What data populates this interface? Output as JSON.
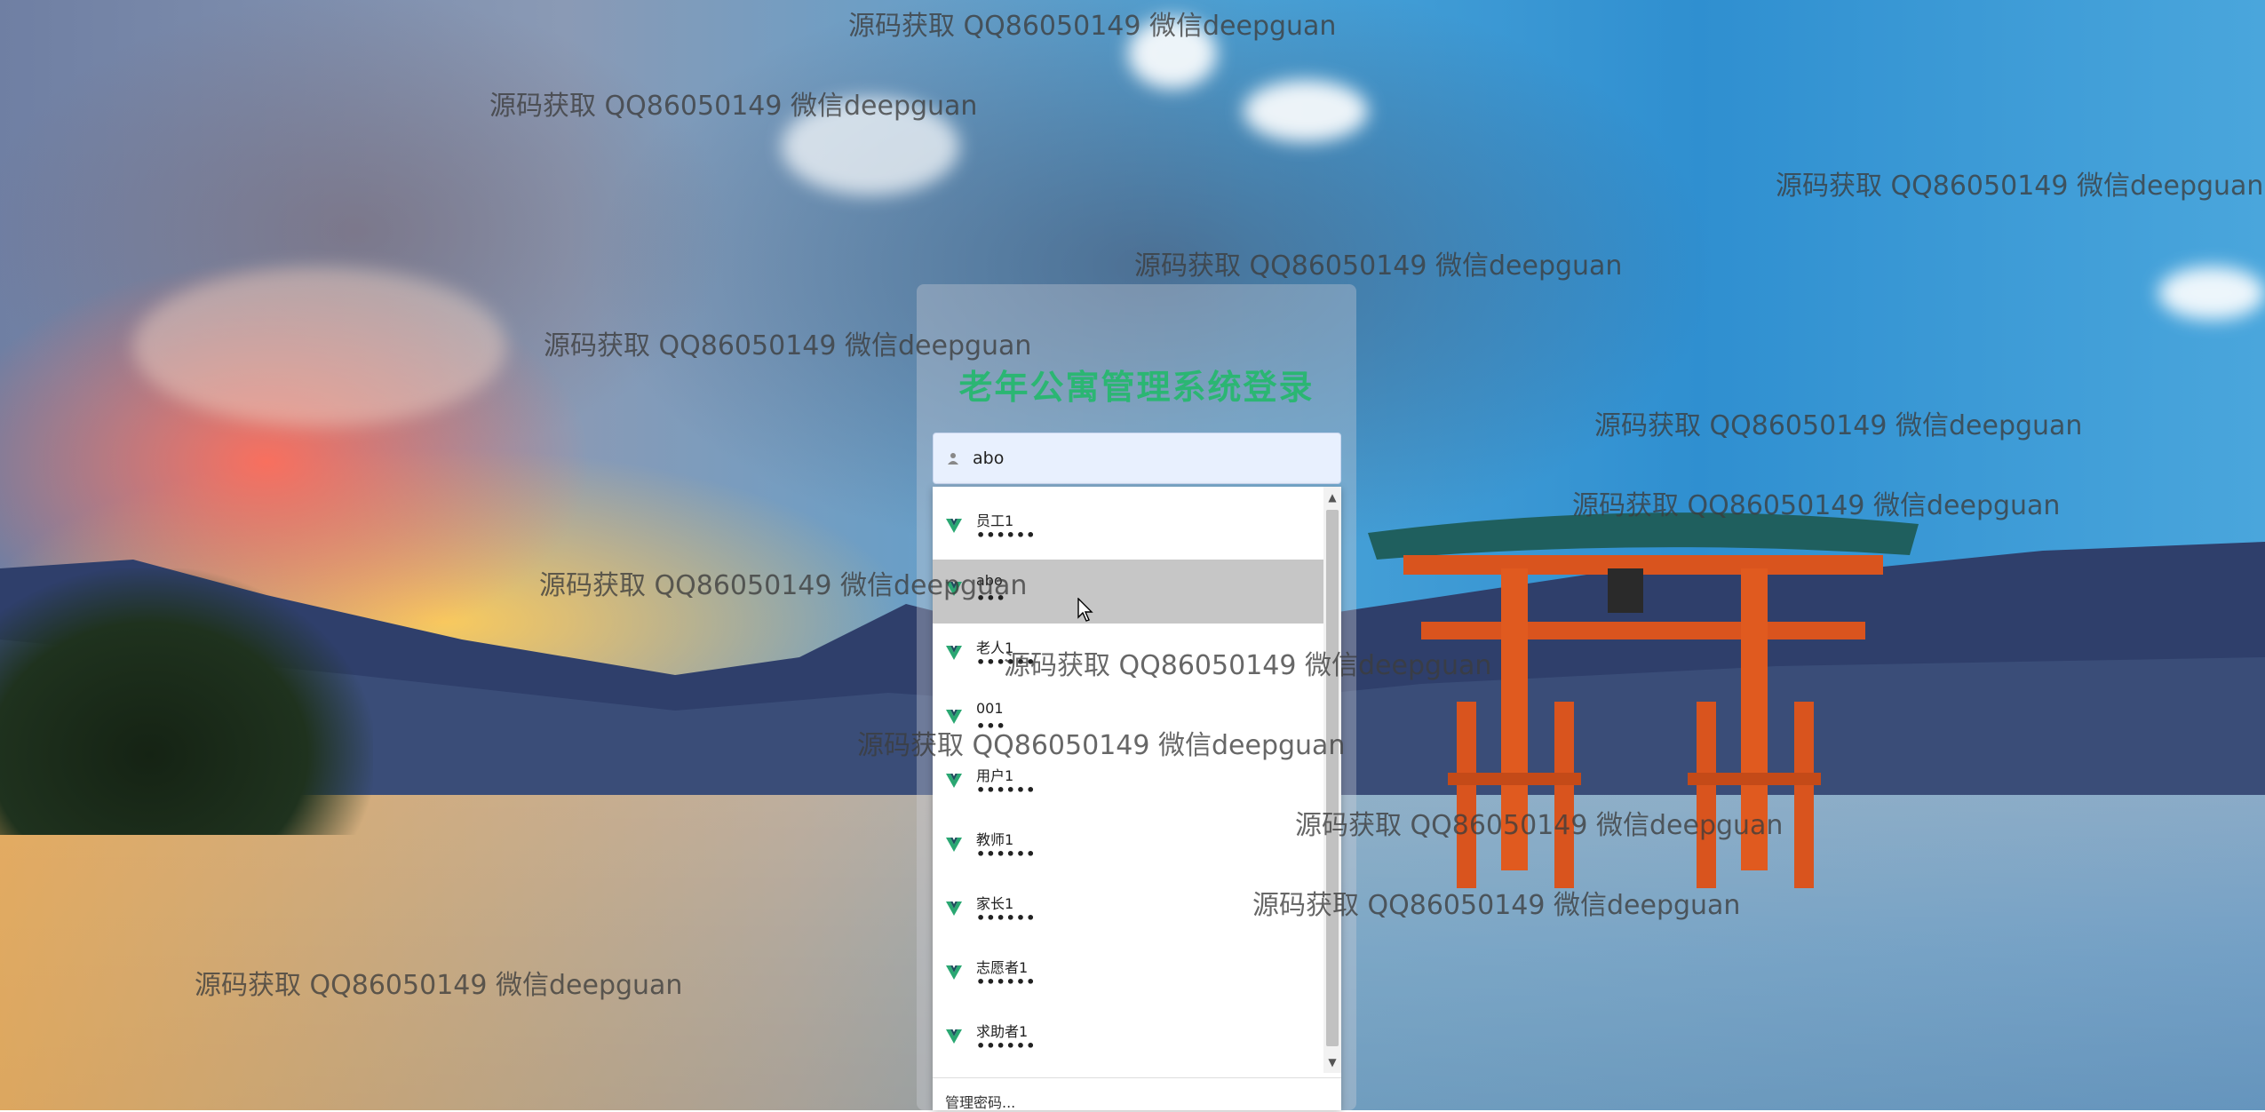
{
  "page": {
    "title": "老年公寓管理系统登录"
  },
  "login": {
    "username_value": "abo",
    "username_icon": "user-icon"
  },
  "autofill": {
    "items": [
      {
        "name": "员工1",
        "password": "••••••"
      },
      {
        "name": "abo",
        "password": "•••"
      },
      {
        "name": "老人1",
        "password": "••••••"
      },
      {
        "name": "001",
        "password": "•••"
      },
      {
        "name": "用户1",
        "password": "••••••"
      },
      {
        "name": "教师1",
        "password": "••••••"
      },
      {
        "name": "家长1",
        "password": "••••••"
      },
      {
        "name": "志愿者1",
        "password": "••••••"
      },
      {
        "name": "求助者1",
        "password": "••••••"
      }
    ],
    "hover_index": 1,
    "item_icon": "key-icon",
    "footer_label": "管理密码..."
  },
  "watermark": {
    "text": "源码获取 QQ86050149 微信deepguan"
  },
  "colors": {
    "title": "#2bb673",
    "input_bg": "#e8f0fe",
    "hover_row": "#c6c6c6"
  }
}
